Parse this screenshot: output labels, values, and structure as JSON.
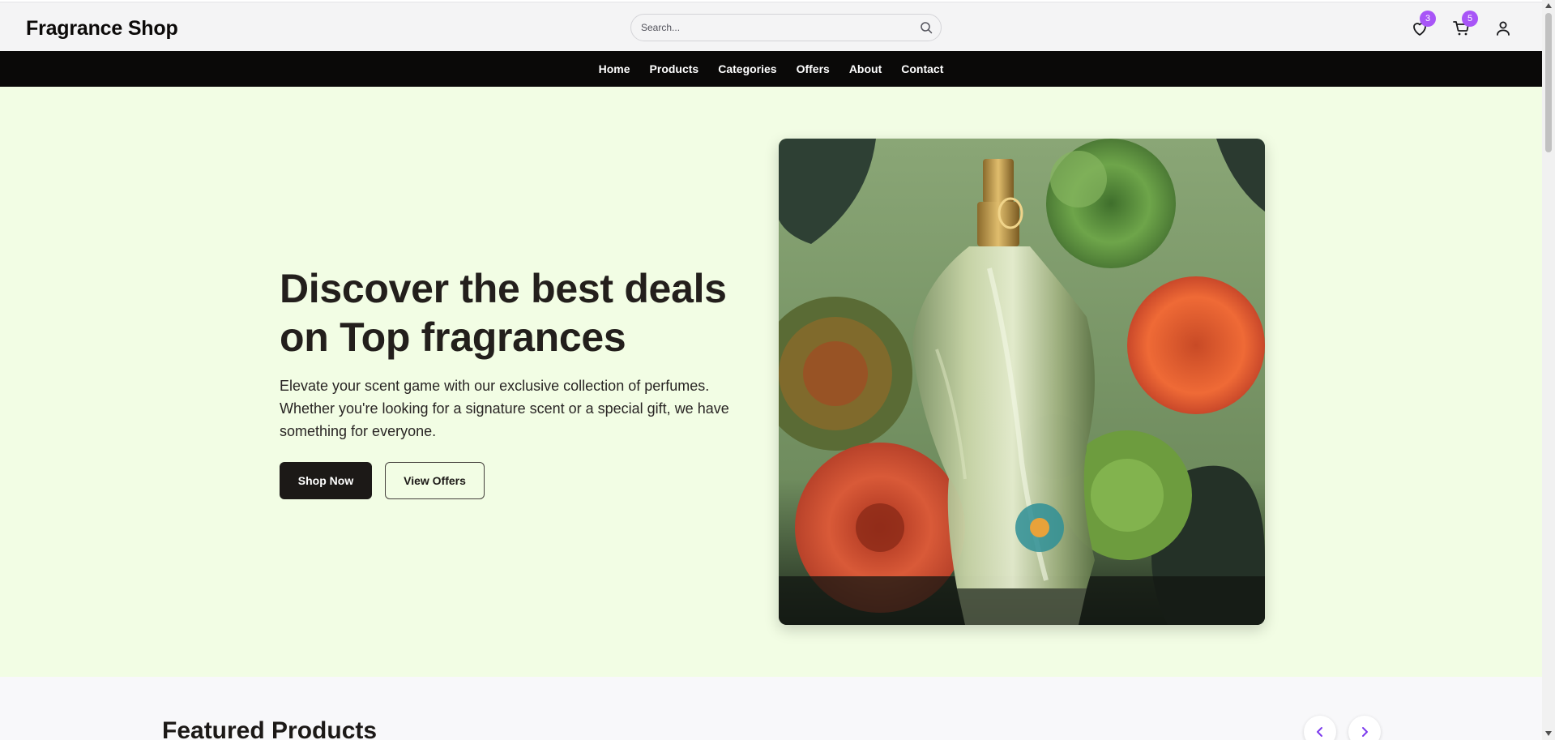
{
  "header": {
    "logo": "Fragrance Shop",
    "search_placeholder": "Search...",
    "wishlist_count": "3",
    "cart_count": "5"
  },
  "nav": {
    "items": [
      "Home",
      "Products",
      "Categories",
      "Offers",
      "About",
      "Contact"
    ]
  },
  "hero": {
    "title": "Discover the best deals on Top fragrances",
    "text": "Elevate your scent game with our exclusive collection of perfumes. Whether you're looking for a signature scent or a special gift, we have something for everyone.",
    "primary_button": "Shop Now",
    "secondary_button": "View Offers"
  },
  "featured": {
    "title": "Featured Products"
  },
  "colors": {
    "accent": "#a855f7",
    "nav_bg": "#0a0908",
    "hero_bg": "#f2fde4",
    "primary_button": "#1c1917"
  },
  "icons": {
    "search": "search-icon",
    "wishlist": "heart-icon",
    "cart": "cart-icon",
    "account": "user-icon",
    "prev": "chevron-left-icon",
    "next": "chevron-right-icon"
  }
}
